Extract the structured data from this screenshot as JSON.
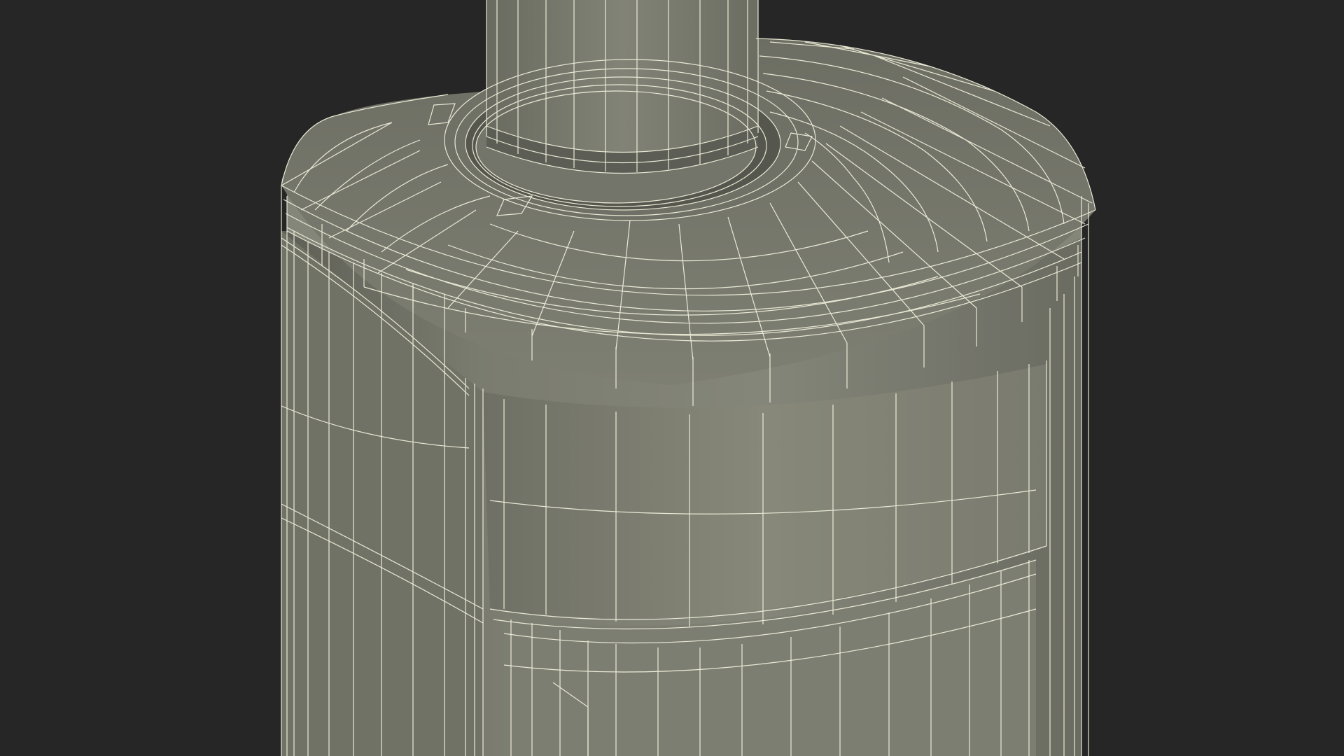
{
  "viewport": {
    "background_color": "#262626"
  },
  "model": {
    "surface_color": "#7a7b6f",
    "surface_dark_color": "#5f6057",
    "surface_light_color": "#8a8b7f",
    "wire_color": "#f1f0dc"
  }
}
